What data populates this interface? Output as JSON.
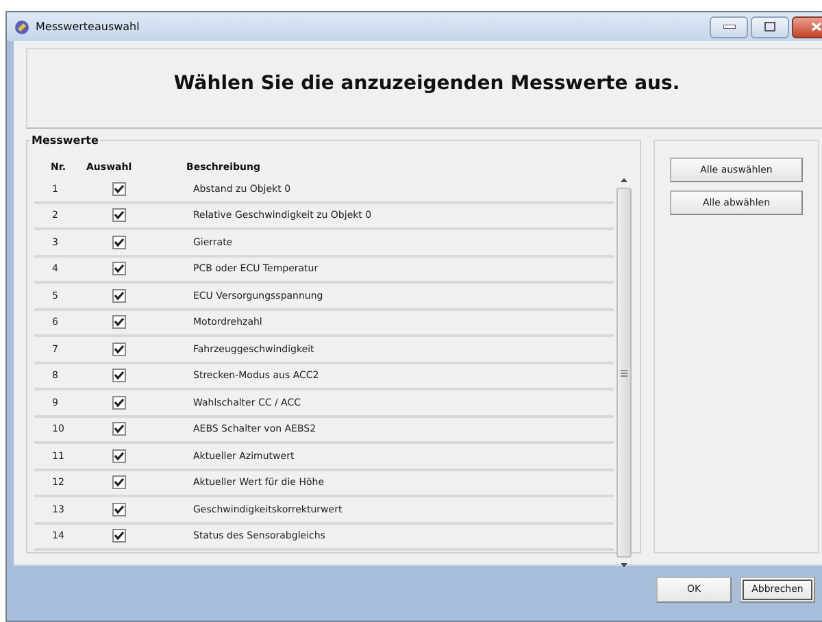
{
  "window": {
    "title": "Messwerteauswahl"
  },
  "header": {
    "text": "Wählen Sie die anzuzeigenden Messwerte aus."
  },
  "group": {
    "title": "Messwerte"
  },
  "table": {
    "columns": [
      "Nr.",
      "Auswahl",
      "Beschreibung"
    ],
    "rows": [
      {
        "nr": "1",
        "checked": true,
        "description": "Abstand zu Objekt 0"
      },
      {
        "nr": "2",
        "checked": true,
        "description": "Relative Geschwindigkeit zu Objekt 0"
      },
      {
        "nr": "3",
        "checked": true,
        "description": "Gierrate"
      },
      {
        "nr": "4",
        "checked": true,
        "description": "PCB oder ECU Temperatur"
      },
      {
        "nr": "5",
        "checked": true,
        "description": "ECU Versorgungsspannung"
      },
      {
        "nr": "6",
        "checked": true,
        "description": "Motordrehzahl"
      },
      {
        "nr": "7",
        "checked": true,
        "description": "Fahrzeuggeschwindigkeit"
      },
      {
        "nr": "8",
        "checked": true,
        "description": "Strecken-Modus aus ACC2"
      },
      {
        "nr": "9",
        "checked": true,
        "description": "Wahlschalter CC / ACC"
      },
      {
        "nr": "10",
        "checked": true,
        "description": "AEBS Schalter von AEBS2"
      },
      {
        "nr": "11",
        "checked": true,
        "description": "Aktueller Azimutwert"
      },
      {
        "nr": "12",
        "checked": true,
        "description": "Aktueller Wert für die Höhe"
      },
      {
        "nr": "13",
        "checked": true,
        "description": "Geschwindigkeitskorrekturwert"
      },
      {
        "nr": "14",
        "checked": true,
        "description": "Status des Sensorabgleichs"
      }
    ]
  },
  "side_buttons": [
    "Alle auswählen",
    "Alle abwählen"
  ],
  "footer_buttons": [
    "OK",
    "Abbrechen"
  ]
}
